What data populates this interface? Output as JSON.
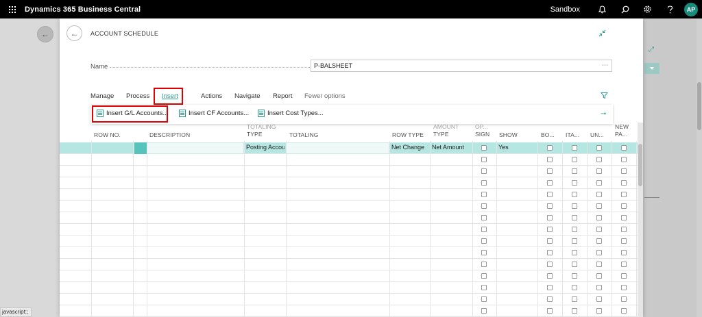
{
  "topbar": {
    "app_title": "Dynamics 365 Business Central",
    "environment": "Sandbox",
    "avatar_initials": "AP"
  },
  "dialog": {
    "title": "ACCOUNT SCHEDULE",
    "name_label": "Name",
    "name_value": "P-BALSHEET",
    "name_more": "⋯"
  },
  "actionbar": {
    "items": [
      "Manage",
      "Process",
      "Insert",
      "Actions",
      "Navigate",
      "Report",
      "Fewer options"
    ]
  },
  "subbar": {
    "items": [
      "Insert G/L Accounts...",
      "Insert CF Accounts...",
      "Insert Cost Types..."
    ]
  },
  "grid": {
    "headers": {
      "row_no": "ROW NO.",
      "description": "DESCRIPTION",
      "totaling_type_1": "TOTALING",
      "totaling_type_2": "TYPE",
      "totaling": "TOTALING",
      "row_type": "ROW TYPE",
      "amount_type_1": "AMOUNT",
      "amount_type_2": "TYPE",
      "op_sign_1": "OP...",
      "op_sign_2": "SIGN",
      "show": "SHOW",
      "bold": "BO...",
      "italic": "ITA...",
      "underline": "UN...",
      "new_page_1": "NEW",
      "new_page_2": "PA..."
    },
    "first_row": {
      "totaling_type": "Posting Accou",
      "row_type": "Net Change",
      "amount_type": "Net Amount",
      "show": "Yes"
    },
    "row_count": 15
  },
  "status_tip": "javascript:;",
  "colors": {
    "accent": "#2a9a8e",
    "selected_row": "#b6e6e2",
    "highlight_box": "#e00000"
  }
}
